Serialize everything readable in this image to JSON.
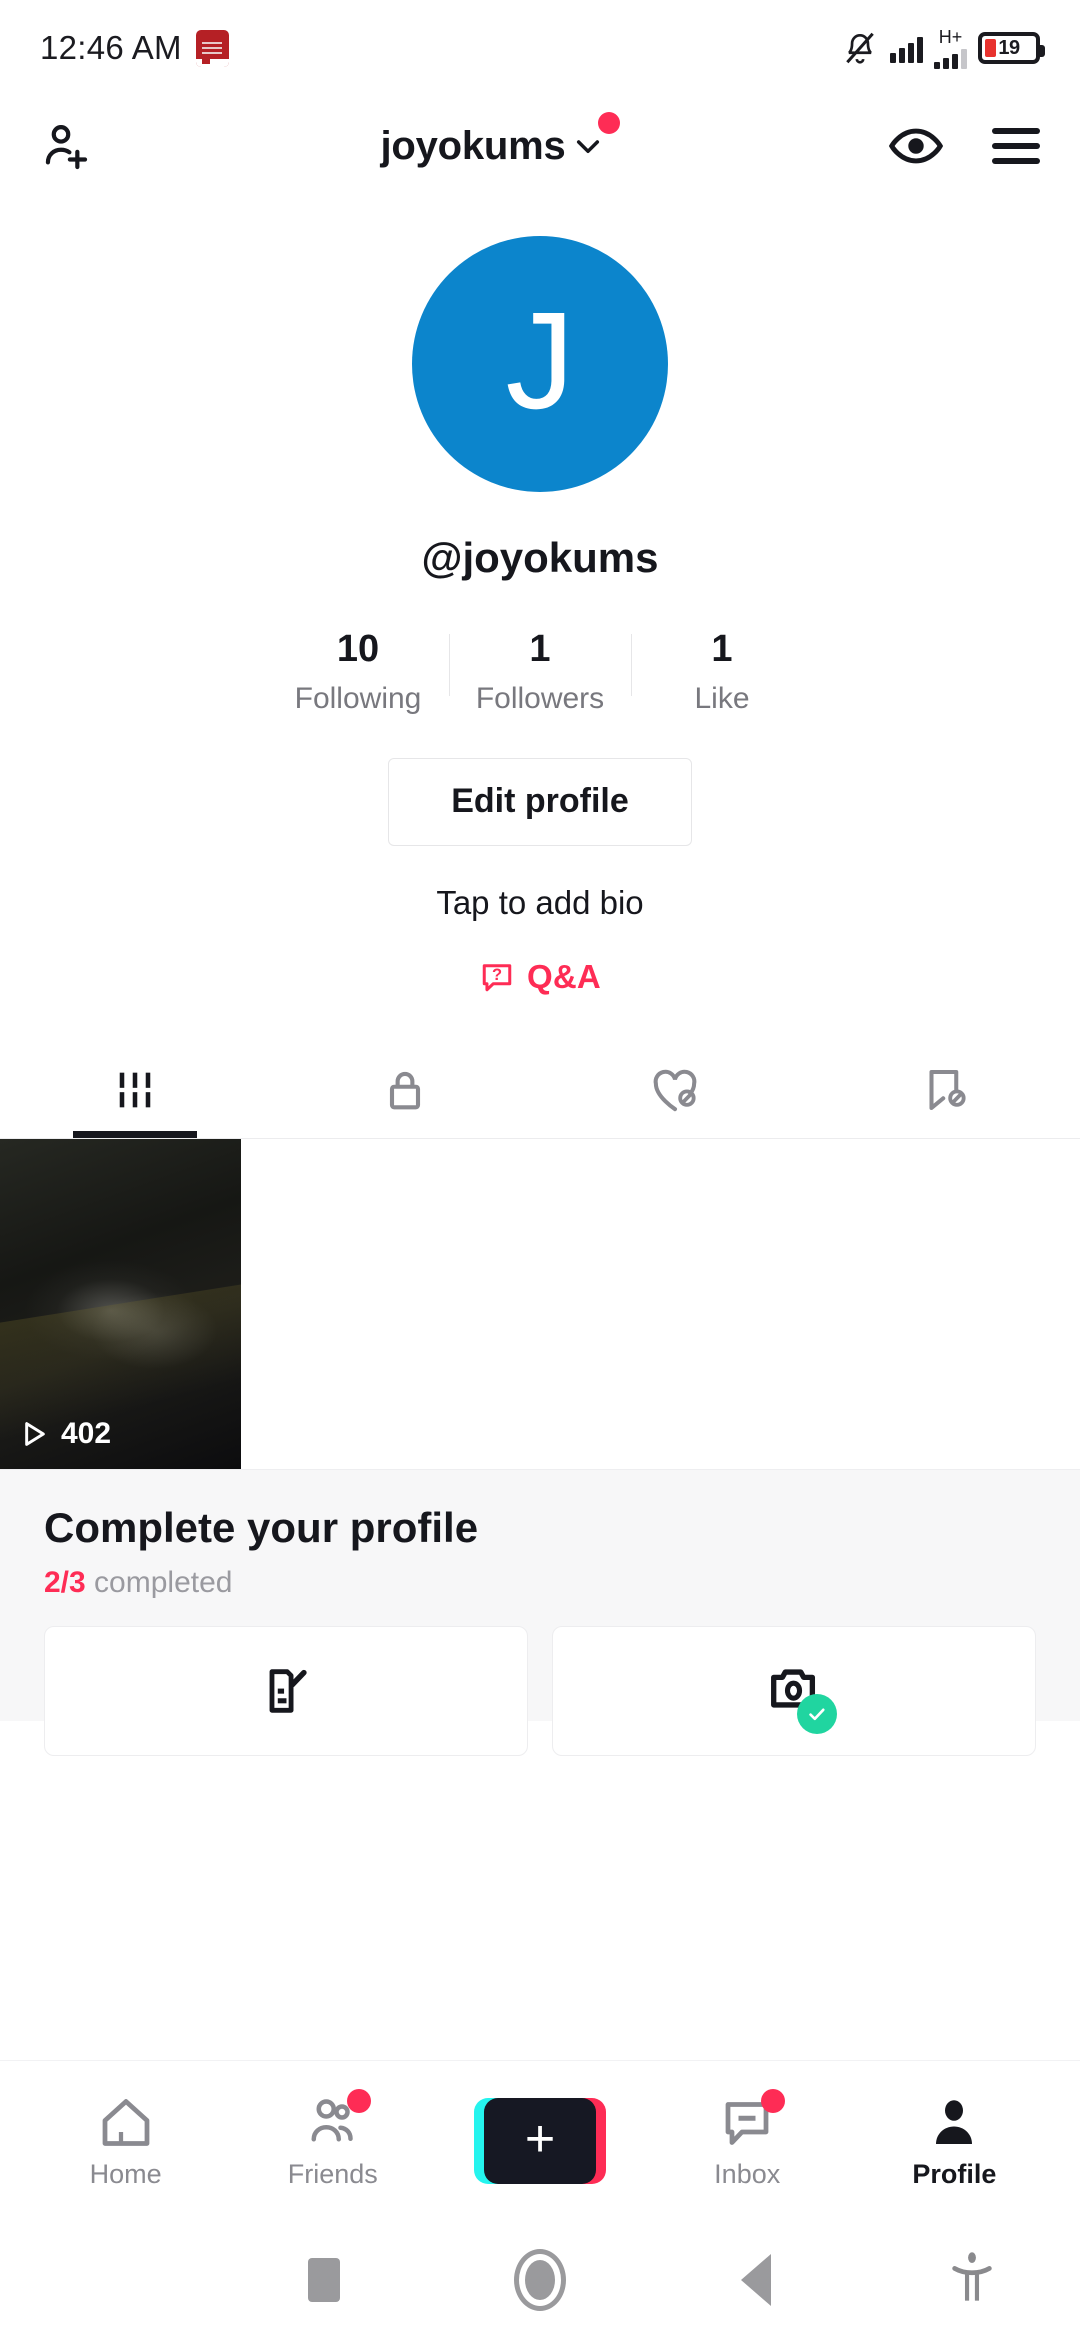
{
  "status_bar": {
    "time": "12:46 AM",
    "app_icon": "bible-app-icon",
    "silent_icon": "bell-muted-icon",
    "network_type": "H+",
    "battery_percent": "19"
  },
  "header": {
    "add_friend_icon": "add-person-icon",
    "username": "joyokums",
    "chevron_icon": "chevron-down-icon",
    "notification_dot": true,
    "eye_icon": "eye-icon",
    "menu_icon": "hamburger-menu-icon"
  },
  "profile": {
    "avatar_letter": "J",
    "avatar_color": "#0c85cc",
    "handle": "@joyokums",
    "stats": [
      {
        "value": "10",
        "label": "Following"
      },
      {
        "value": "1",
        "label": "Followers"
      },
      {
        "value": "1",
        "label": "Like"
      }
    ],
    "edit_button": "Edit profile",
    "bio_placeholder": "Tap to add bio",
    "qa_label": "Q&A",
    "qa_icon": "question-bubble-icon",
    "accent_color": "#fe2c55"
  },
  "tabs": [
    {
      "name": "videos",
      "icon": "grid-bars-icon",
      "active": true
    },
    {
      "name": "private",
      "icon": "lock-icon",
      "active": false
    },
    {
      "name": "liked",
      "icon": "heart-hidden-icon",
      "active": false
    },
    {
      "name": "favorites",
      "icon": "bookmark-hidden-icon",
      "active": false
    }
  ],
  "videos": [
    {
      "play_count": "402",
      "play_icon": "play-triangle-icon"
    }
  ],
  "complete_profile": {
    "title": "Complete your profile",
    "progress": "2/3",
    "progress_suffix": " completed",
    "tasks": [
      {
        "icon": "edit-document-icon",
        "completed": false
      },
      {
        "icon": "camera-icon",
        "completed": true,
        "badge_color": "#20d5a0"
      }
    ]
  },
  "bottom_nav": {
    "items": [
      {
        "label": "Home",
        "icon": "home-icon",
        "active": false,
        "badge": false
      },
      {
        "label": "Friends",
        "icon": "friends-icon",
        "active": false,
        "badge": true
      },
      {
        "label": "",
        "icon": "create-plus-icon",
        "active": false,
        "badge": false
      },
      {
        "label": "Inbox",
        "icon": "inbox-icon",
        "active": false,
        "badge": true
      },
      {
        "label": "Profile",
        "icon": "person-icon",
        "active": true,
        "badge": false
      }
    ]
  },
  "system_nav": {
    "recents_icon": "square-recents-icon",
    "home_icon": "circle-home-icon",
    "back_icon": "triangle-back-icon",
    "accessibility_icon": "accessibility-icon"
  }
}
